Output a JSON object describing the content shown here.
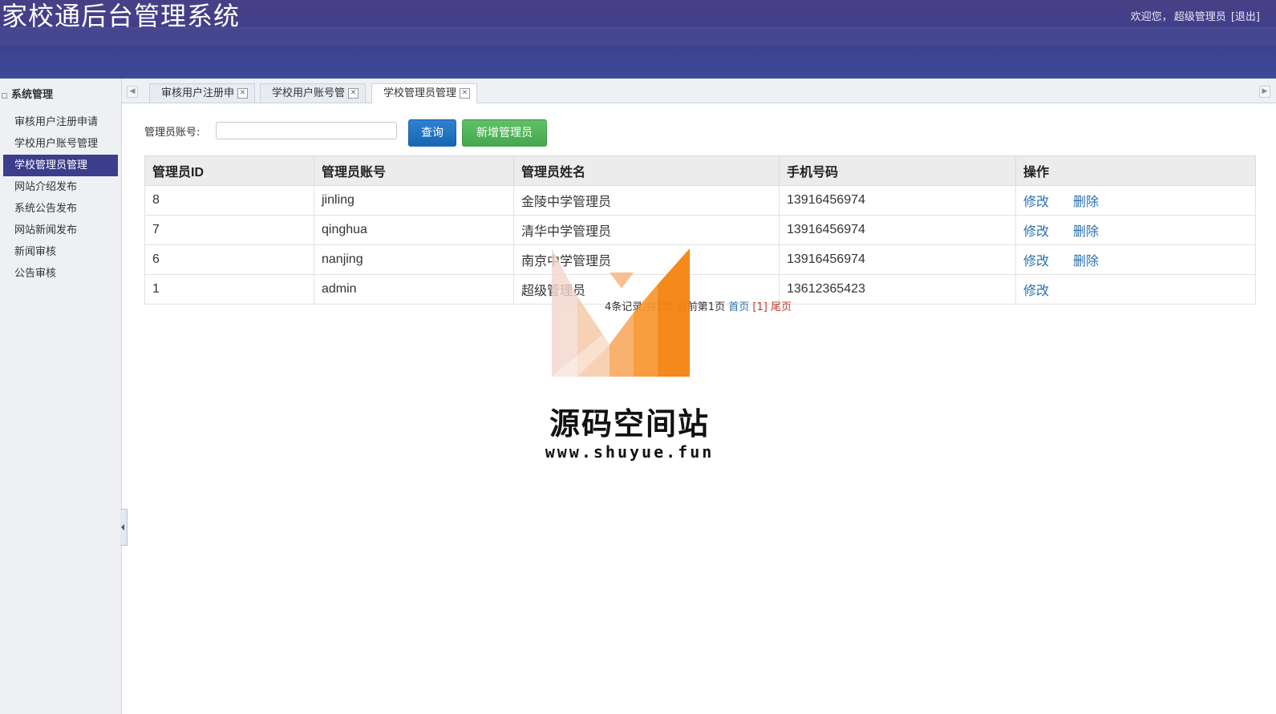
{
  "header": {
    "title": "家校通后台管理系统",
    "welcome_label": "欢迎您，",
    "user": "超级管理员",
    "logout": "[退出]"
  },
  "sidebar": {
    "section_title": "系统管理",
    "items": [
      {
        "label": "审核用户注册申请"
      },
      {
        "label": "学校用户账号管理"
      },
      {
        "label": "学校管理员管理",
        "active": true
      },
      {
        "label": "网站介绍发布"
      },
      {
        "label": "系统公告发布"
      },
      {
        "label": "网站新闻发布"
      },
      {
        "label": "新闻审核"
      },
      {
        "label": "公告审核"
      }
    ]
  },
  "tabs": [
    {
      "label": "审核用户注册申"
    },
    {
      "label": "学校用户账号管"
    },
    {
      "label": "学校管理员管理",
      "active": true
    }
  ],
  "search": {
    "label": "管理员账号:",
    "value": "",
    "query_button": "查询",
    "add_button": "新增管理员"
  },
  "table": {
    "headers": [
      "管理员ID",
      "管理员账号",
      "管理员姓名",
      "手机号码",
      "操作"
    ],
    "rows": [
      {
        "id": "8",
        "account": "jinling",
        "name": "金陵中学管理员",
        "phone": "13916456974",
        "edit": "修改",
        "delete": "删除"
      },
      {
        "id": "7",
        "account": "qinghua",
        "name": "清华中学管理员",
        "phone": "13916456974",
        "edit": "修改",
        "delete": "删除"
      },
      {
        "id": "6",
        "account": "nanjing",
        "name": "南京中学管理员",
        "phone": "13916456974",
        "edit": "修改",
        "delete": "删除"
      },
      {
        "id": "1",
        "account": "admin",
        "name": "超级管理员",
        "phone": "13612365423",
        "edit": "修改",
        "delete": ""
      }
    ]
  },
  "pager": {
    "summary": "4条记录,共1页 当前第1页",
    "first": "首页",
    "current": "[1]",
    "last": "尾页"
  },
  "watermark": {
    "text": "源码空间站",
    "url": "www.shuyue.fun"
  }
}
